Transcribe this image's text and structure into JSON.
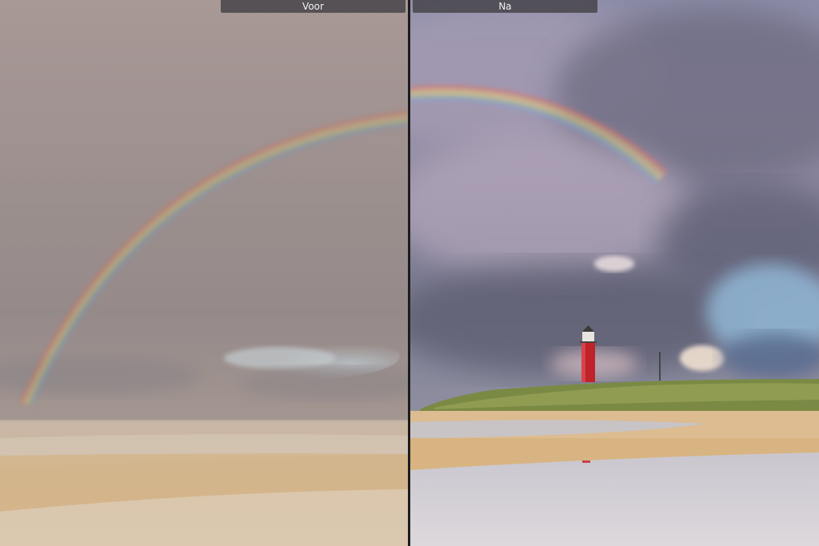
{
  "labels": {
    "before": "Voor",
    "after": "Na"
  },
  "colors": {
    "divider": "#1c1c1c",
    "label_background": "#46444a",
    "label_text": "#f2f2f2",
    "lighthouse": "#c0222a"
  }
}
